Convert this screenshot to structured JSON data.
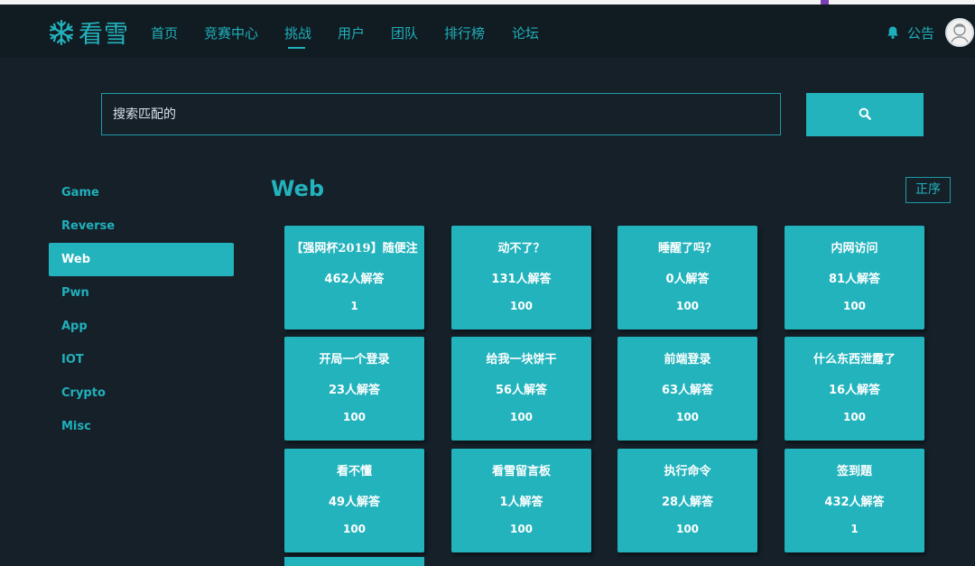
{
  "brand": {
    "logo_text": "看雪"
  },
  "nav": {
    "items": [
      {
        "id": "home",
        "label": "首页"
      },
      {
        "id": "contest",
        "label": "竞赛中心"
      },
      {
        "id": "challenge",
        "label": "挑战",
        "active": true
      },
      {
        "id": "users",
        "label": "用户"
      },
      {
        "id": "team",
        "label": "团队"
      },
      {
        "id": "ranking",
        "label": "排行榜"
      },
      {
        "id": "forum",
        "label": "论坛"
      }
    ],
    "notice_label": "公告"
  },
  "search": {
    "placeholder": "搜索匹配的"
  },
  "sidebar": {
    "items": [
      {
        "label": "Game"
      },
      {
        "label": "Reverse"
      },
      {
        "label": "Web",
        "active": true
      },
      {
        "label": "Pwn"
      },
      {
        "label": "App"
      },
      {
        "label": "IOT"
      },
      {
        "label": "Crypto"
      },
      {
        "label": "Misc"
      }
    ]
  },
  "section": {
    "title": "Web",
    "sort_label": "正序"
  },
  "challenges": [
    {
      "title": "【强网杯2019】随便注",
      "solved": "462人解答",
      "score": "1"
    },
    {
      "title": "动不了？",
      "solved": "131人解答",
      "score": "100"
    },
    {
      "title": "睡醒了吗？",
      "solved": "0人解答",
      "score": "100"
    },
    {
      "title": "内网访问",
      "solved": "81人解答",
      "score": "100"
    },
    {
      "title": "开局一个登录",
      "solved": "23人解答",
      "score": "100"
    },
    {
      "title": "给我一块饼干",
      "solved": "56人解答",
      "score": "100"
    },
    {
      "title": "前端登录",
      "solved": "63人解答",
      "score": "100"
    },
    {
      "title": "什么东西泄露了",
      "solved": "16人解答",
      "score": "100"
    },
    {
      "title": "看不懂",
      "solved": "49人解答",
      "score": "100"
    },
    {
      "title": "看雪留言板",
      "solved": "1人解答",
      "score": "100"
    },
    {
      "title": "执行命令",
      "solved": "28人解答",
      "score": "100"
    },
    {
      "title": "签到题",
      "solved": "432人解答",
      "score": "1"
    }
  ],
  "colors": {
    "accent": "#22b3bd",
    "background": "#152029",
    "navbar": "#111b22"
  },
  "icons": {
    "logo": "snowflake-icon",
    "search": "search-icon",
    "notice": "bell-icon",
    "user": "avatar"
  }
}
